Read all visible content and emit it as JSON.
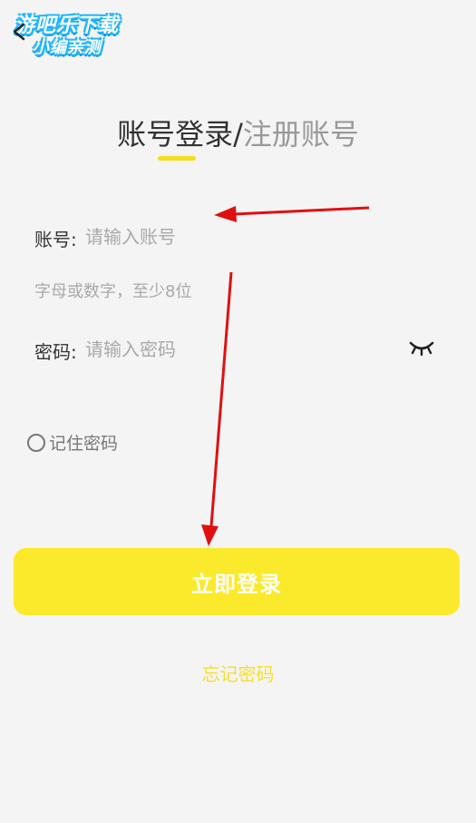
{
  "watermark": {
    "line1": "游吧乐下载",
    "line2": "小编亲测"
  },
  "header": {
    "tab_login": "账号登录",
    "separator": "/",
    "tab_register": "注册账号"
  },
  "form": {
    "account_label": "账号:",
    "account_placeholder": "请输入账号",
    "account_hint": "字母或数字，至少8位",
    "password_label": "密码:",
    "password_placeholder": "请输入密码",
    "password_toggle_icon": "eye-closed-icon",
    "remember_label": "记住密码",
    "remember_checked": false
  },
  "actions": {
    "login_label": "立即登录",
    "forgot_label": "忘记密码"
  },
  "colors": {
    "accent_yellow": "#fbea2b",
    "indicator_yellow": "#f5df1a",
    "forgot_text": "#f3df2e",
    "annotation_red": "#e01010",
    "background": "#f4f4f4"
  }
}
